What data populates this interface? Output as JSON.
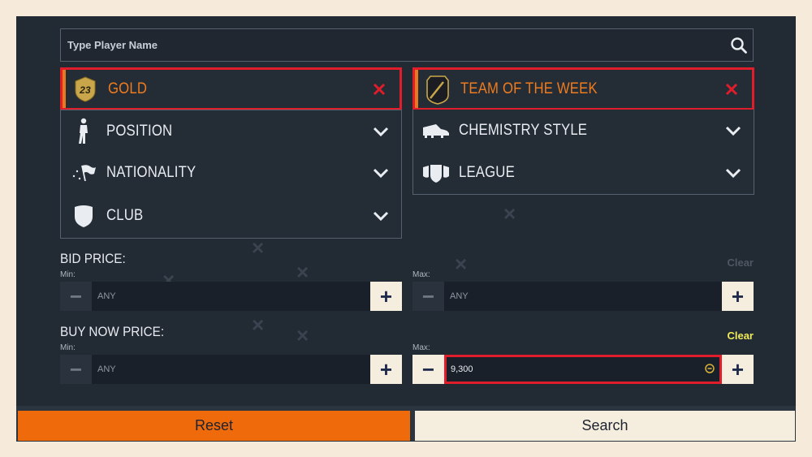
{
  "search": {
    "placeholder": "Type Player Name",
    "icon": "search-icon"
  },
  "filters": {
    "quality": {
      "label": "GOLD",
      "badge": "23",
      "active": true
    },
    "rarity": {
      "label": "TEAM OF THE WEEK",
      "active": true
    },
    "position": {
      "label": "POSITION"
    },
    "chemistry": {
      "label": "CHEMISTRY STYLE"
    },
    "nationality": {
      "label": "NATIONALITY"
    },
    "league": {
      "label": "LEAGUE"
    },
    "club": {
      "label": "CLUB"
    }
  },
  "bid_price": {
    "title": "BID PRICE:",
    "clear_label": "Clear",
    "min_label": "Min:",
    "max_label": "Max:",
    "min_value": "ANY",
    "max_value": "ANY"
  },
  "buy_now_price": {
    "title": "BUY NOW PRICE:",
    "clear_label": "Clear",
    "min_label": "Min:",
    "max_label": "Max:",
    "min_value": "ANY",
    "max_value": "9,300"
  },
  "buttons": {
    "reset": "Reset",
    "search": "Search"
  },
  "colors": {
    "accent_orange": "#ef6a0a",
    "highlight_red": "#e01d2a",
    "panel": "#222a34",
    "clear_active": "#f0ea5a",
    "clear_inactive": "#4e5863"
  }
}
